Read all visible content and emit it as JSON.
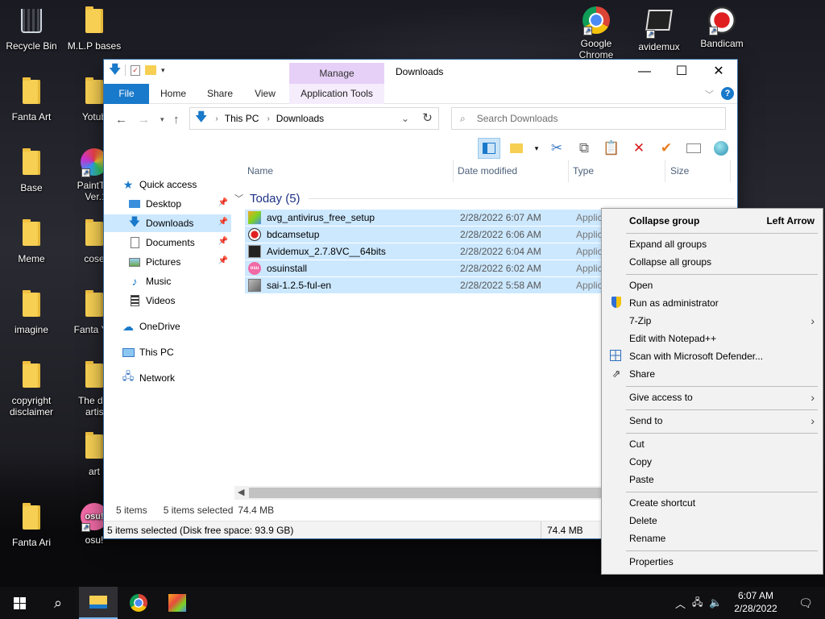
{
  "desktop": {
    "icons": [
      {
        "label": "Recycle Bin",
        "icon": "recycle-bin-icon"
      },
      {
        "label": "M.L.P bases",
        "icon": "folder-icon"
      },
      {
        "label": "Fanta Art",
        "icon": "folder-icon"
      },
      {
        "label": "Yotub",
        "icon": "folder-icon"
      },
      {
        "label": "Base",
        "icon": "folder-icon"
      },
      {
        "label": "PaintToo Ver.1",
        "icon": "painttool-sai-icon"
      },
      {
        "label": "Meme",
        "icon": "folder-icon"
      },
      {
        "label": "cose",
        "icon": "folder-icon"
      },
      {
        "label": "imagine",
        "icon": "folder-icon"
      },
      {
        "label": "Fanta Yot",
        "icon": "folder-icon"
      },
      {
        "label": "copyright disclaimer",
        "icon": "folder-icon"
      },
      {
        "label": "The dea artist",
        "icon": "folder-icon"
      },
      {
        "label": "art",
        "icon": "folder-icon"
      },
      {
        "label": "Fanta Ari",
        "icon": "folder-icon"
      },
      {
        "label": "osu!",
        "icon": "osu-icon"
      },
      {
        "label": "Google Chrome",
        "icon": "chrome-icon"
      },
      {
        "label": "avidemux",
        "icon": "avidemux-icon"
      },
      {
        "label": "Bandicam",
        "icon": "bandicam-icon"
      }
    ]
  },
  "explorer": {
    "title": "Downloads",
    "contextual_tab": "Manage",
    "ribbon_tabs": [
      "File",
      "Home",
      "Share",
      "View",
      "Application Tools"
    ],
    "breadcrumb": [
      "This PC",
      "Downloads"
    ],
    "search_placeholder": "Search Downloads",
    "nav": {
      "quick_access": "Quick access",
      "items": [
        "Desktop",
        "Downloads",
        "Documents",
        "Pictures",
        "Music",
        "Videos"
      ],
      "onedrive": "OneDrive",
      "thispc": "This PC",
      "network": "Network"
    },
    "columns": [
      "Name",
      "Date modified",
      "Type",
      "Size"
    ],
    "group_label": "Today (5)",
    "files": [
      {
        "name": "avg_antivirus_free_setup",
        "date": "2/28/2022 6:07 AM",
        "type": "Applic",
        "icon": "avg-icon"
      },
      {
        "name": "bdcamsetup",
        "date": "2/28/2022 6:06 AM",
        "type": "Applic",
        "icon": "bandicam-icon"
      },
      {
        "name": "Avidemux_2.7.8VC__64bits",
        "date": "2/28/2022 6:04 AM",
        "type": "Applic",
        "icon": "avidemux-icon"
      },
      {
        "name": "osuinstall",
        "date": "2/28/2022 6:02 AM",
        "type": "Applic",
        "icon": "osu-icon"
      },
      {
        "name": "sai-1.2.5-ful-en",
        "date": "2/28/2022 5:58 AM",
        "type": "Applic",
        "icon": "installer-icon"
      }
    ],
    "status": {
      "items": "5 items",
      "selected": "5 items selected",
      "size": "74.4 MB"
    },
    "bottom": {
      "left": "5 items selected (Disk free space: 93.9 GB)",
      "size": "74.4 MB"
    }
  },
  "context_menu": {
    "collapse_group": "Collapse group",
    "collapse_group_shortcut": "Left Arrow",
    "expand_all": "Expand all groups",
    "collapse_all": "Collapse all groups",
    "open": "Open",
    "run_admin": "Run as administrator",
    "seven_zip": "7-Zip",
    "notepadpp": "Edit with Notepad++",
    "defender": "Scan with Microsoft Defender...",
    "share": "Share",
    "give_access": "Give access to",
    "send_to": "Send to",
    "cut": "Cut",
    "copy": "Copy",
    "paste": "Paste",
    "create_shortcut": "Create shortcut",
    "delete": "Delete",
    "rename": "Rename",
    "properties": "Properties"
  },
  "taskbar": {
    "time": "6:07 AM",
    "date": "2/28/2022"
  },
  "colors": {
    "accent": "#1979ca",
    "selection": "#cce8ff",
    "manage_tab": "#e7d0f7"
  }
}
